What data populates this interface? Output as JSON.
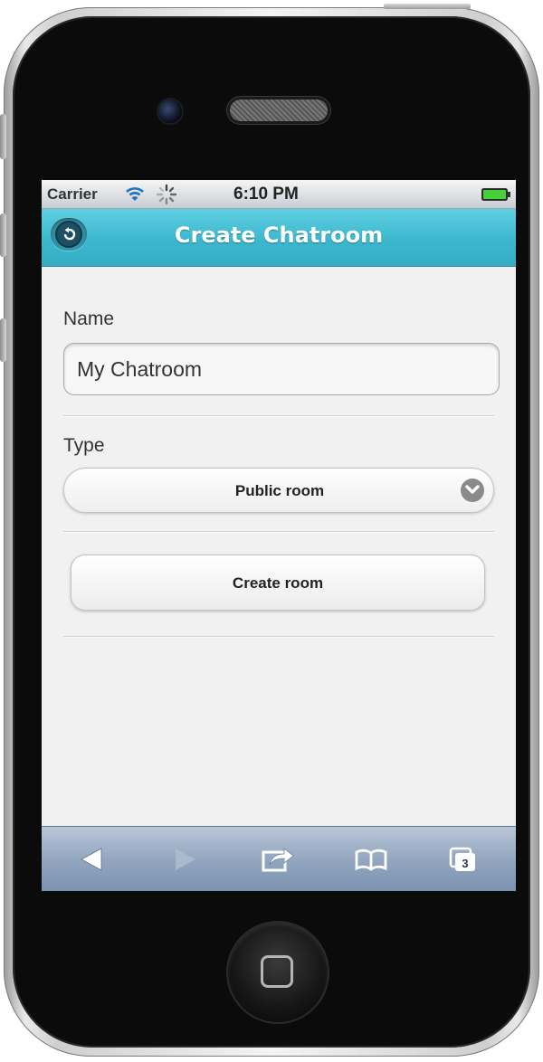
{
  "status_bar": {
    "carrier": "Carrier",
    "time": "6:10 PM",
    "wifi_icon": "wifi-icon",
    "activity_icon": "activity-spinner-icon",
    "battery_icon": "battery-icon"
  },
  "nav": {
    "title": "Create Chatroom",
    "back_icon": "back-arrow-icon",
    "accent_color": "#3bb7cd"
  },
  "form": {
    "name_label": "Name",
    "name_value": "My Chatroom",
    "type_label": "Type",
    "type_selected": "Public room",
    "submit_label": "Create room"
  },
  "browser_toolbar": {
    "items": [
      "back-arrow-icon",
      "forward-arrow-icon",
      "share-icon",
      "bookmarks-icon",
      "tabs-icon"
    ],
    "tabs_count": "3"
  }
}
